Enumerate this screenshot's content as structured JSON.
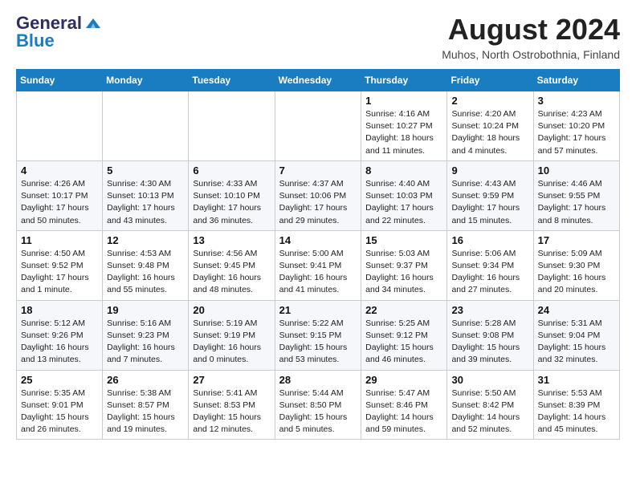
{
  "header": {
    "logo_general": "General",
    "logo_blue": "Blue",
    "month_year": "August 2024",
    "location": "Muhos, North Ostrobothnia, Finland"
  },
  "weekdays": [
    "Sunday",
    "Monday",
    "Tuesday",
    "Wednesday",
    "Thursday",
    "Friday",
    "Saturday"
  ],
  "weeks": [
    [
      {
        "day": "",
        "info": ""
      },
      {
        "day": "",
        "info": ""
      },
      {
        "day": "",
        "info": ""
      },
      {
        "day": "",
        "info": ""
      },
      {
        "day": "1",
        "info": "Sunrise: 4:16 AM\nSunset: 10:27 PM\nDaylight: 18 hours\nand 11 minutes."
      },
      {
        "day": "2",
        "info": "Sunrise: 4:20 AM\nSunset: 10:24 PM\nDaylight: 18 hours\nand 4 minutes."
      },
      {
        "day": "3",
        "info": "Sunrise: 4:23 AM\nSunset: 10:20 PM\nDaylight: 17 hours\nand 57 minutes."
      }
    ],
    [
      {
        "day": "4",
        "info": "Sunrise: 4:26 AM\nSunset: 10:17 PM\nDaylight: 17 hours\nand 50 minutes."
      },
      {
        "day": "5",
        "info": "Sunrise: 4:30 AM\nSunset: 10:13 PM\nDaylight: 17 hours\nand 43 minutes."
      },
      {
        "day": "6",
        "info": "Sunrise: 4:33 AM\nSunset: 10:10 PM\nDaylight: 17 hours\nand 36 minutes."
      },
      {
        "day": "7",
        "info": "Sunrise: 4:37 AM\nSunset: 10:06 PM\nDaylight: 17 hours\nand 29 minutes."
      },
      {
        "day": "8",
        "info": "Sunrise: 4:40 AM\nSunset: 10:03 PM\nDaylight: 17 hours\nand 22 minutes."
      },
      {
        "day": "9",
        "info": "Sunrise: 4:43 AM\nSunset: 9:59 PM\nDaylight: 17 hours\nand 15 minutes."
      },
      {
        "day": "10",
        "info": "Sunrise: 4:46 AM\nSunset: 9:55 PM\nDaylight: 17 hours\nand 8 minutes."
      }
    ],
    [
      {
        "day": "11",
        "info": "Sunrise: 4:50 AM\nSunset: 9:52 PM\nDaylight: 17 hours\nand 1 minute."
      },
      {
        "day": "12",
        "info": "Sunrise: 4:53 AM\nSunset: 9:48 PM\nDaylight: 16 hours\nand 55 minutes."
      },
      {
        "day": "13",
        "info": "Sunrise: 4:56 AM\nSunset: 9:45 PM\nDaylight: 16 hours\nand 48 minutes."
      },
      {
        "day": "14",
        "info": "Sunrise: 5:00 AM\nSunset: 9:41 PM\nDaylight: 16 hours\nand 41 minutes."
      },
      {
        "day": "15",
        "info": "Sunrise: 5:03 AM\nSunset: 9:37 PM\nDaylight: 16 hours\nand 34 minutes."
      },
      {
        "day": "16",
        "info": "Sunrise: 5:06 AM\nSunset: 9:34 PM\nDaylight: 16 hours\nand 27 minutes."
      },
      {
        "day": "17",
        "info": "Sunrise: 5:09 AM\nSunset: 9:30 PM\nDaylight: 16 hours\nand 20 minutes."
      }
    ],
    [
      {
        "day": "18",
        "info": "Sunrise: 5:12 AM\nSunset: 9:26 PM\nDaylight: 16 hours\nand 13 minutes."
      },
      {
        "day": "19",
        "info": "Sunrise: 5:16 AM\nSunset: 9:23 PM\nDaylight: 16 hours\nand 7 minutes."
      },
      {
        "day": "20",
        "info": "Sunrise: 5:19 AM\nSunset: 9:19 PM\nDaylight: 16 hours\nand 0 minutes."
      },
      {
        "day": "21",
        "info": "Sunrise: 5:22 AM\nSunset: 9:15 PM\nDaylight: 15 hours\nand 53 minutes."
      },
      {
        "day": "22",
        "info": "Sunrise: 5:25 AM\nSunset: 9:12 PM\nDaylight: 15 hours\nand 46 minutes."
      },
      {
        "day": "23",
        "info": "Sunrise: 5:28 AM\nSunset: 9:08 PM\nDaylight: 15 hours\nand 39 minutes."
      },
      {
        "day": "24",
        "info": "Sunrise: 5:31 AM\nSunset: 9:04 PM\nDaylight: 15 hours\nand 32 minutes."
      }
    ],
    [
      {
        "day": "25",
        "info": "Sunrise: 5:35 AM\nSunset: 9:01 PM\nDaylight: 15 hours\nand 26 minutes."
      },
      {
        "day": "26",
        "info": "Sunrise: 5:38 AM\nSunset: 8:57 PM\nDaylight: 15 hours\nand 19 minutes."
      },
      {
        "day": "27",
        "info": "Sunrise: 5:41 AM\nSunset: 8:53 PM\nDaylight: 15 hours\nand 12 minutes."
      },
      {
        "day": "28",
        "info": "Sunrise: 5:44 AM\nSunset: 8:50 PM\nDaylight: 15 hours\nand 5 minutes."
      },
      {
        "day": "29",
        "info": "Sunrise: 5:47 AM\nSunset: 8:46 PM\nDaylight: 14 hours\nand 59 minutes."
      },
      {
        "day": "30",
        "info": "Sunrise: 5:50 AM\nSunset: 8:42 PM\nDaylight: 14 hours\nand 52 minutes."
      },
      {
        "day": "31",
        "info": "Sunrise: 5:53 AM\nSunset: 8:39 PM\nDaylight: 14 hours\nand 45 minutes."
      }
    ]
  ]
}
